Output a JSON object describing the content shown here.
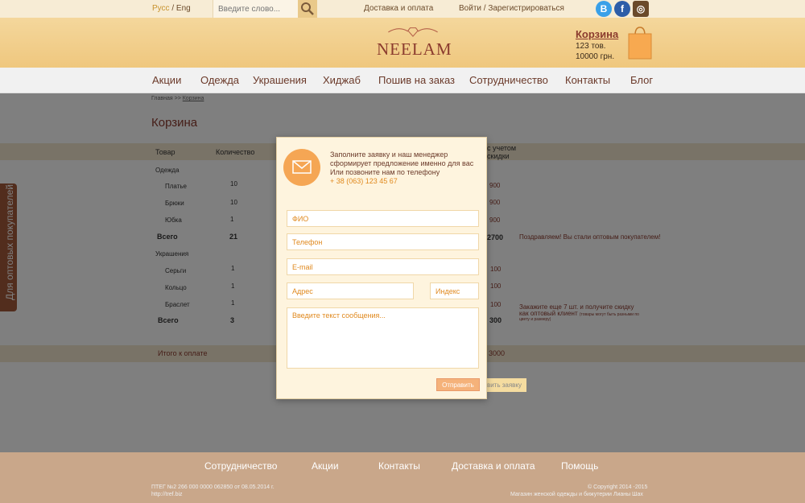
{
  "topbar": {
    "lang_ru": "Русс",
    "lang_sep": " / ",
    "lang_en": "Eng",
    "search_placeholder": "Введите слово...",
    "delivery_link": "Доставка и оплата",
    "login_link": "Войти / Зарегистрироваться",
    "social": {
      "vk": "B",
      "fb": "f",
      "ig": "◎"
    }
  },
  "header": {
    "logo": "NEELAM",
    "cart_title": "Корзина",
    "cart_count": "123 тов.",
    "cart_sum": "10000 грн."
  },
  "nav": {
    "items": [
      "Акции",
      "Одежда",
      "Украшения",
      "Хиджаб",
      "Пошив на заказ",
      "Сотрудничество",
      "Контакты",
      "Блог"
    ]
  },
  "page": {
    "breadcrumb_home": "Главная",
    "breadcrumb_sep": " >> ",
    "breadcrumb_current": "Корзина",
    "title": "Корзина",
    "table": {
      "col_product": "Товар",
      "col_qty": "Количество",
      "col_discount_1": "с учетом",
      "col_discount_2": "скидки",
      "group1": "Одежда",
      "group1_items": [
        {
          "name": "Платье",
          "qty": "10",
          "price": "900"
        },
        {
          "name": "Брюки",
          "qty": "10",
          "price": "900"
        },
        {
          "name": "Юбка",
          "qty": "1",
          "price": "900"
        }
      ],
      "group1_total_label": "Всего",
      "group1_total_qty": "21",
      "group1_total_price": "2700",
      "group1_note": "Поздравляем! Вы стали оптовым покупателем!",
      "group2": "Украшения",
      "group2_items": [
        {
          "name": "Серьги",
          "qty": "1",
          "price": "100"
        },
        {
          "name": "Кольцо",
          "qty": "1",
          "price": "100"
        },
        {
          "name": "Браслет",
          "qty": "1",
          "price": "100"
        }
      ],
      "group2_total_label": "Всего",
      "group2_total_qty": "3",
      "group2_total_price": "300",
      "group2_note_1": "Закажите еще 7 шт. и получите скидку",
      "group2_note_2": "как оптовый клиент",
      "group2_note_small_1": "(товары могут быть разными по",
      "group2_note_small_2": "цвету и размеру)",
      "total_label": "Итого к оплате",
      "total_value": "3000",
      "ghost_button": "вить заявку"
    }
  },
  "side_tab": "Для оптовых покупателей",
  "modal": {
    "line1": "Заполните заявку и наш менеджер",
    "line2": "сформирует предложение именно для вас",
    "line3": "Или позвоните нам по телефону",
    "phone": "+ 38 (063) 123 45 67",
    "fio_placeholder": "ФИО",
    "phone_placeholder": "Телефон",
    "email_placeholder": "E-mail",
    "address_placeholder": "Адрес",
    "index_placeholder": "Индекс",
    "message_placeholder": "Введите текст сообщения...",
    "send_label": "Отправить"
  },
  "footer": {
    "links": [
      "Сотрудничество",
      "Акции",
      "Контакты",
      "Доставка и оплата",
      "Помощь"
    ],
    "left_1": "ПТЕГ №2 266 000 0000 062850 от 08.05.2014 г.",
    "left_2": "http://tref.biz",
    "right_1": "© Copyright 2014 -2015",
    "right_2": "Магазин женской одежды и бижутерии Лианы Шах"
  },
  "colors": {
    "accent": "#8b3b2e",
    "orange": "#e0891e",
    "footer_bg": "#c9a78a"
  }
}
